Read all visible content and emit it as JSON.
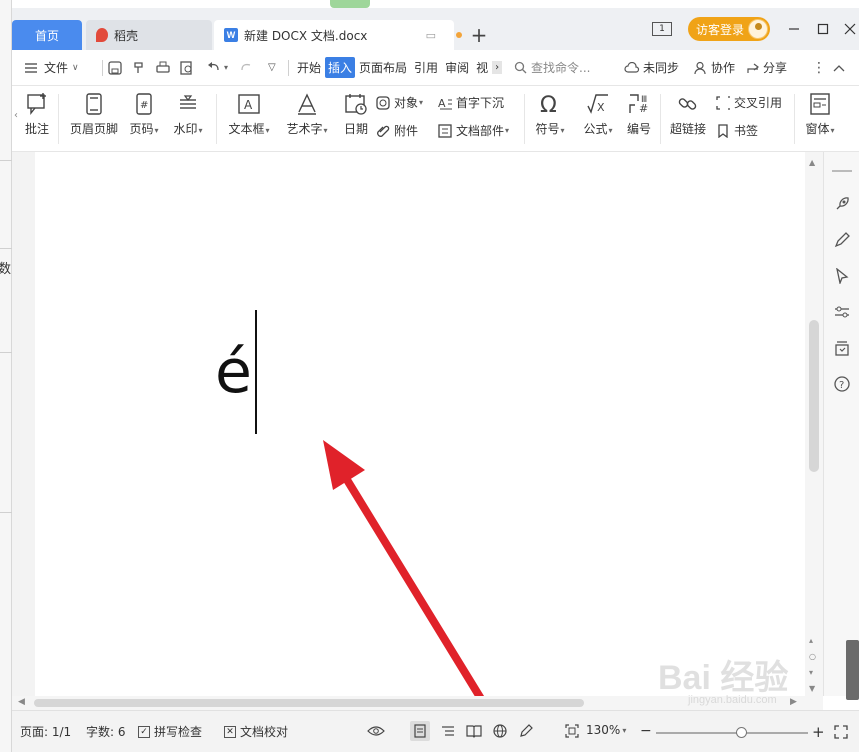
{
  "tabs": {
    "home": "首页",
    "daoke": "稻壳",
    "document": "新建 DOCX 文档.docx",
    "new_tab": "+"
  },
  "titlebar": {
    "window_count": "1",
    "login": "访客登录"
  },
  "menubar": {
    "file": "文件",
    "tabs": [
      "开始",
      "插入",
      "页面布局",
      "引用",
      "审阅",
      "视"
    ],
    "active_tab": "插入",
    "search_placeholder": "查找命令...",
    "unsync": "未同步",
    "collab": "协作",
    "share": "分享"
  },
  "ribbon": {
    "comment": "批注",
    "header_footer": "页眉页脚",
    "page_number": "页码",
    "watermark": "水印",
    "textbox": "文本框",
    "wordart": "艺术字",
    "date": "日期",
    "object": "对象",
    "attachment": "附件",
    "dropcap": "首字下沉",
    "doc_parts": "文档部件",
    "symbol": "符号",
    "formula": "公式",
    "numbering": "编号",
    "hyperlink": "超链接",
    "cross_ref": "交叉引用",
    "bookmark": "书签",
    "window": "窗体"
  },
  "document": {
    "content": "é"
  },
  "statusbar": {
    "page": "页面: 1/1",
    "word_count": "字数: 6",
    "spell_check": "拼写检查",
    "doc_proof": "文档校对",
    "zoom": "130%"
  },
  "background": {
    "left_fragment": "数"
  },
  "watermark": {
    "main": "Bai 经验",
    "sub": "jingyan.baidu.com"
  },
  "colors": {
    "accent": "#3b7fe4",
    "login": "#f0a317",
    "arrow": "#e0222a"
  }
}
